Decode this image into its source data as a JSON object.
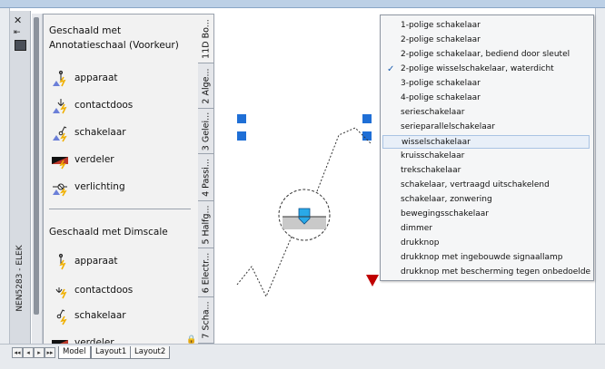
{
  "palette": {
    "vertical_title": "NEN5283 - ELEK",
    "sections": [
      {
        "title_line1": "Geschaald met",
        "title_line2": "Annotatieschaal (Voorkeur)",
        "tools": [
          "apparaat",
          "contactdoos",
          "schakelaar",
          "verdeler",
          "verlichting"
        ]
      },
      {
        "title_line1": "Geschaald met Dimscale",
        "tools": [
          "apparaat",
          "contactdoos",
          "schakelaar",
          "verdeler"
        ]
      }
    ],
    "tabs": [
      "11D Bo...",
      "2 Alge...",
      "3 Gelei...",
      "4 Passi...",
      "5 Halfg...",
      "6 Electr...",
      "7 Scha..."
    ]
  },
  "layout_tabs": [
    "Model",
    "Layout1",
    "Layout2"
  ],
  "nav_buttons": [
    "◂◂",
    "◂",
    "▸",
    "▸▸"
  ],
  "dropdown": {
    "items": [
      "1-polige schakelaar",
      "2-polige schakelaar",
      "2-polige schakelaar, bediend door sleutel",
      "2-polige wisselschakelaar, waterdicht",
      "3-polige schakelaar",
      "4-polige schakelaar",
      "serieschakelaar",
      "serieparallelschakelaar",
      "wisselschakelaar",
      "kruisschakelaar",
      "trekschakelaar",
      "schakelaar, vertraagd uitschakelend",
      "schakelaar, zonwering",
      "bewegingsschakelaar",
      "dimmer",
      "drukknop",
      "drukknop met ingebouwde signaallamp",
      "drukknop met bescherming tegen onbedoelde"
    ],
    "checked_index": 3,
    "highlighted_index": 8,
    "check_mark": "✓"
  },
  "colors": {
    "grip": "#1f6fd6",
    "symbol_fill": "#29a9e8",
    "arrow": "#c00000"
  }
}
